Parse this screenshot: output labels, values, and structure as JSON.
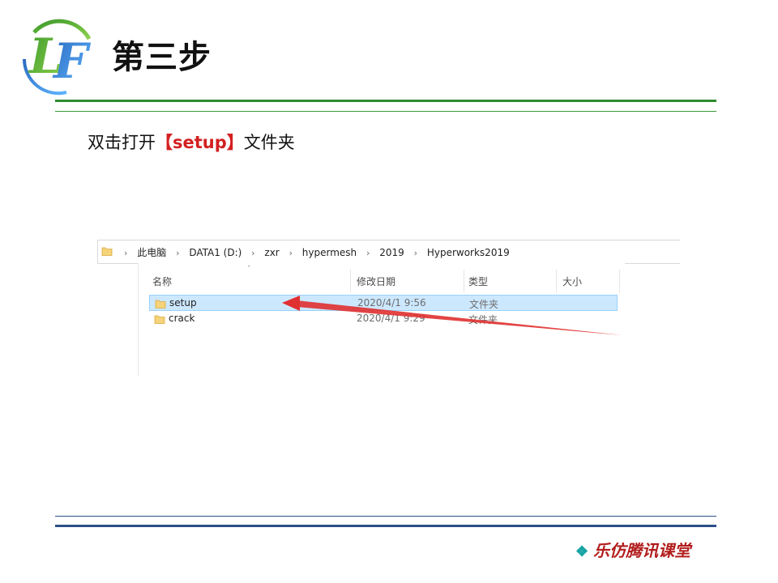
{
  "slide": {
    "logo_text": "LF",
    "title": "第三步",
    "instruction_prefix": "双击打开",
    "instruction_highlight": "【setup】",
    "instruction_suffix": "文件夹",
    "brand": "乐仿腾讯课堂",
    "brand_icon": "diamond-cluster-icon"
  },
  "explorer": {
    "breadcrumbs": [
      "此电脑",
      "DATA1 (D:)",
      "zxr",
      "hypermesh",
      "2019",
      "Hyperworks2019"
    ],
    "columns": [
      "名称",
      "修改日期",
      "类型",
      "大小"
    ],
    "files": [
      {
        "name": "setup",
        "date": "2020/4/1 9:56",
        "type": "文件夹",
        "size": "",
        "selected": true
      },
      {
        "name": "crack",
        "date": "2020/4/1 9:29",
        "type": "文件夹",
        "size": "",
        "selected": false
      }
    ]
  },
  "colors": {
    "accent_green": "#2e8b2e",
    "accent_blue": "#2c4f8a",
    "highlight_red": "#d32020",
    "selection_blue": "#cce8ff",
    "arrow_red": "#e03030"
  }
}
